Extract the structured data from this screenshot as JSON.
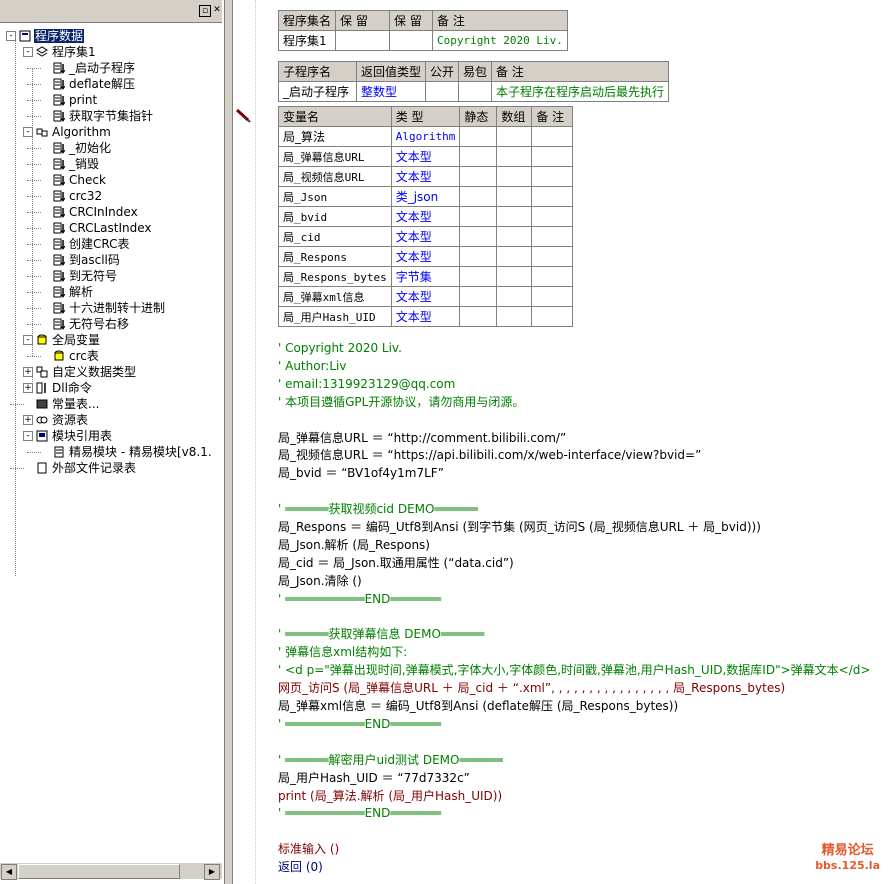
{
  "tree": {
    "items": [
      {
        "label": "程序数据",
        "icon": "program-data-icon"
      },
      {
        "label": "程序集1",
        "icon": "assembly-icon"
      },
      {
        "label": "_启动子程序",
        "icon": "subroutine-icon"
      },
      {
        "label": "deflate解压",
        "icon": "subroutine-icon"
      },
      {
        "label": "print",
        "icon": "subroutine-icon"
      },
      {
        "label": "获取字节集指针",
        "icon": "subroutine-icon"
      },
      {
        "label": "Algorithm",
        "icon": "class-icon"
      },
      {
        "label": "_初始化",
        "icon": "subroutine-icon"
      },
      {
        "label": "_销毁",
        "icon": "subroutine-icon"
      },
      {
        "label": "Check",
        "icon": "subroutine-icon"
      },
      {
        "label": "crc32",
        "icon": "subroutine-icon"
      },
      {
        "label": "CRCInIndex",
        "icon": "subroutine-icon"
      },
      {
        "label": "CRCLastIndex",
        "icon": "subroutine-icon"
      },
      {
        "label": "创建CRC表",
        "icon": "subroutine-icon"
      },
      {
        "label": "到ascll码",
        "icon": "subroutine-icon"
      },
      {
        "label": "到无符号",
        "icon": "subroutine-icon"
      },
      {
        "label": "解析",
        "icon": "subroutine-icon"
      },
      {
        "label": "十六进制转十进制",
        "icon": "subroutine-icon"
      },
      {
        "label": "无符号右移",
        "icon": "subroutine-icon"
      },
      {
        "label": "全局变量",
        "icon": "global-var-icon"
      },
      {
        "label": "crc表",
        "icon": "variable-icon"
      },
      {
        "label": "自定义数据类型",
        "icon": "datatype-icon"
      },
      {
        "label": "Dll命令",
        "icon": "dll-icon"
      },
      {
        "label": "常量表...",
        "icon": "constant-icon"
      },
      {
        "label": "资源表",
        "icon": "resource-icon"
      },
      {
        "label": "模块引用表",
        "icon": "module-icon"
      },
      {
        "label": "精易模块 - 精易模块[v8.1.",
        "icon": "module-file-icon"
      },
      {
        "label": "外部文件记录表",
        "icon": "file-record-icon"
      }
    ]
  },
  "assembly_table": {
    "headers": [
      "程序集名",
      "保 留",
      "保 留",
      "备 注"
    ],
    "row": [
      "程序集1",
      "",
      "",
      "Copyright 2020 Liv."
    ]
  },
  "sub_table": {
    "headers": [
      "子程序名",
      "返回值类型",
      "公开",
      "易包",
      "备 注"
    ],
    "row": [
      "_启动子程序",
      "整数型",
      "",
      "",
      "本子程序在程序启动后最先执行"
    ]
  },
  "var_table": {
    "headers": [
      "变量名",
      "类 型",
      "静态",
      "数组",
      "备 注"
    ],
    "rows": [
      [
        "局_算法",
        "Algorithm"
      ],
      [
        "局_弹幕信息URL",
        "文本型"
      ],
      [
        "局_视频信息URL",
        "文本型"
      ],
      [
        "局_Json",
        "类_json"
      ],
      [
        "局_bvid",
        "文本型"
      ],
      [
        "局_cid",
        "文本型"
      ],
      [
        "局_Respons",
        "文本型"
      ],
      [
        "局_Respons_bytes",
        "字节集"
      ],
      [
        "局_弹幕xml信息",
        "文本型"
      ],
      [
        "局_用户Hash_UID",
        "文本型"
      ]
    ]
  },
  "code_lines": [
    "' Copyright 2020 Liv.",
    "' Author:Liv",
    "' email:1319923129@qq.com",
    "' 本项目遵循GPL开源协议，请勿商用与闭源。",
    "",
    "局_弹幕信息URL ＝ “http://comment.bilibili.com/”",
    "局_视频信息URL ＝ “https://api.bilibili.com/x/web-interface/view?bvid=”",
    "局_bvid ＝ “BV1of4y1m7LF”",
    "",
    "' ══════获取视频cid DEMO══════",
    "局_Respons ＝ 编码_Utf8到Ansi (到字节集 (网页_访问S (局_视频信息URL ＋ 局_bvid)))",
    "局_Json.解析 (局_Respons)",
    "局_cid ＝ 局_Json.取通用属性 (“data.cid”)",
    "局_Json.清除 ()",
    "' ═══════════END═══════",
    "",
    "' ══════获取弹幕信息 DEMO══════",
    "' 弹幕信息xml结构如下:",
    "' <d p=\"弹幕出现时间,弹幕模式,字体大小,字体颜色,时间戳,弹幕池,用户Hash_UID,数据库ID\">弹幕文本</d>",
    "网页_访问S (局_弹幕信息URL ＋ 局_cid ＋ “.xml”, , , , , , , , , , , , , , , , 局_Respons_bytes)",
    "局_弹幕xml信息 ＝ 编码_Utf8到Ansi (deflate解压 (局_Respons_bytes))",
    "' ═══════════END═══════",
    "",
    "' ══════解密用户uid测试 DEMO══════",
    "局_用户Hash_UID ＝ “77d7332c”",
    "print (局_算法.解析 (局_用户Hash_UID))",
    "' ═══════════END═══════",
    "",
    "标准输入 ()",
    "返回 (0)"
  ],
  "watermark": {
    "line1": "精易论坛",
    "line2": "bbs.125.la"
  }
}
